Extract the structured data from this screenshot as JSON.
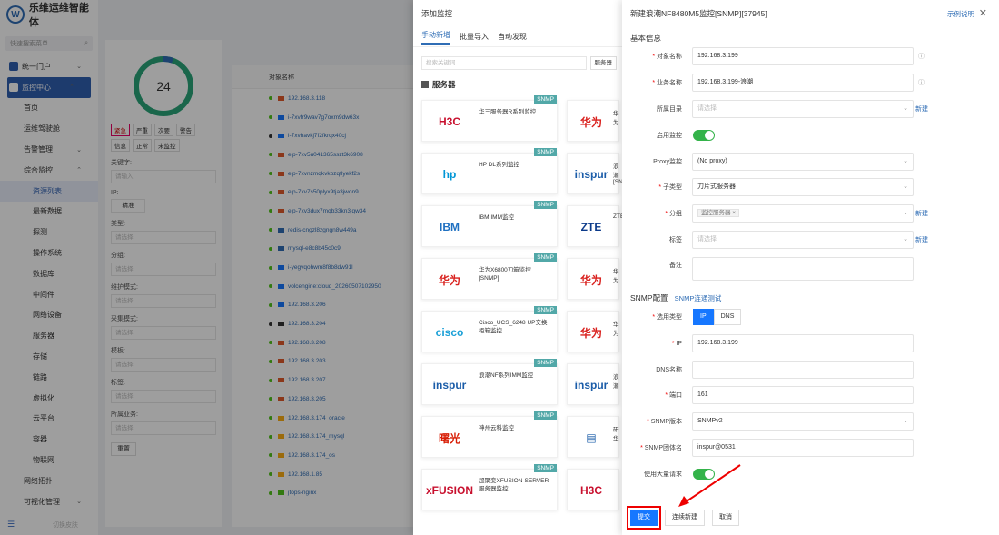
{
  "brand": {
    "name": "乐维运维智能体",
    "logo_letter": "W"
  },
  "sidebar": {
    "search_placeholder": "快速搜索菜单",
    "items": [
      {
        "label": "统一门户",
        "level": 1,
        "chev": "⌄"
      },
      {
        "label": "监控中心",
        "level": 1,
        "chev": "⌃",
        "active": true
      },
      {
        "label": "首页",
        "level": 2
      },
      {
        "label": "运维驾驶舱",
        "level": 2
      },
      {
        "label": "告警管理",
        "level": 2,
        "chev": "⌄"
      },
      {
        "label": "综合监控",
        "level": 2,
        "chev": "⌃"
      },
      {
        "label": "资源列表",
        "level": 3,
        "selected": true
      },
      {
        "label": "最新数据",
        "level": 3
      },
      {
        "label": "探测",
        "level": 3
      },
      {
        "label": "操作系统",
        "level": 3
      },
      {
        "label": "数据库",
        "level": 3
      },
      {
        "label": "中间件",
        "level": 3
      },
      {
        "label": "网络设备",
        "level": 3
      },
      {
        "label": "服务器",
        "level": 3
      },
      {
        "label": "存储",
        "level": 3
      },
      {
        "label": "链路",
        "level": 3
      },
      {
        "label": "虚拟化",
        "level": 3
      },
      {
        "label": "云平台",
        "level": 3
      },
      {
        "label": "容器",
        "level": 3
      },
      {
        "label": "物联网",
        "level": 3
      },
      {
        "label": "网络拓扑",
        "level": 2
      },
      {
        "label": "可视化管理",
        "level": 2,
        "chev": "⌄"
      }
    ],
    "footer": "切换皮肤"
  },
  "filter": {
    "count": "24",
    "tags": [
      "紧急",
      "严重",
      "次要",
      "警告",
      "信息",
      "正常",
      "未监控"
    ],
    "keyword_label": "关键字:",
    "keyword_ph": "请输入",
    "ip_label": "IP:",
    "ip_btn": "精准",
    "type_label": "类型:",
    "type_ph": "请选择",
    "group_label": "分组:",
    "group_ph": "请选择",
    "maint_label": "维护模式:",
    "maint_ph": "请选择",
    "collect_label": "采集模式:",
    "collect_ph": "请选择",
    "template_label": "模板:",
    "template_ph": "请选择",
    "label_label": "标签:",
    "label_ph": "请选择",
    "biz_label": "所属业务:",
    "biz_ph": "请选择",
    "reset": "重置"
  },
  "table": {
    "header": "对象名称",
    "rows": [
      {
        "name": "192.168.3.118",
        "dot": "#52c41a",
        "icon": "#e05a2b"
      },
      {
        "name": "i-7xvfr9wav7g7oxm9dw63x",
        "dot": "#52c41a",
        "icon": "#1677ff"
      },
      {
        "name": "i-7xvhavkj7f2fkrqx40cj",
        "dot": "#333",
        "icon": "#1677ff"
      },
      {
        "name": "eip-7xv5u041365sszt3k6908",
        "dot": "#52c41a",
        "icon": "#e05a2b"
      },
      {
        "name": "eip-7xvnzmqkvkbzqtlyekf2s",
        "dot": "#52c41a",
        "icon": "#e05a2b"
      },
      {
        "name": "eip-7xv7s50plyx9tja3jwon9",
        "dot": "#52c41a",
        "icon": "#e05a2b"
      },
      {
        "name": "eip-7xv3dux7mqb33kn3jqw34",
        "dot": "#52c41a",
        "icon": "#e05a2b"
      },
      {
        "name": "redis-cngzl8zgngn8w449a",
        "dot": "#52c41a",
        "icon": "#2f6db5"
      },
      {
        "name": "mysql-e8c8b45c0c9l",
        "dot": "#52c41a",
        "icon": "#2f6db5"
      },
      {
        "name": "i-yegvqohwm8f8b8dw91l",
        "dot": "#52c41a",
        "icon": "#1677ff"
      },
      {
        "name": "volcengine:cloud_20260507102950",
        "dot": "#52c41a",
        "icon": "#1677ff"
      },
      {
        "name": "192.168.3.206",
        "dot": "#52c41a",
        "icon": "#1677ff"
      },
      {
        "name": "192.168.3.204",
        "dot": "#333",
        "icon": "#333"
      },
      {
        "name": "192.168.3.208",
        "dot": "#52c41a",
        "icon": "#e05a2b"
      },
      {
        "name": "192.168.3.203",
        "dot": "#52c41a",
        "icon": "#e05a2b"
      },
      {
        "name": "192.168.3.207",
        "dot": "#52c41a",
        "icon": "#e05a2b"
      },
      {
        "name": "192.168.3.205",
        "dot": "#52c41a",
        "icon": "#e05a2b"
      },
      {
        "name": "192.168.3.174_oracle",
        "dot": "#52c41a",
        "icon": "#faad14"
      },
      {
        "name": "192.168.3.174_mysql",
        "dot": "#52c41a",
        "icon": "#faad14"
      },
      {
        "name": "192.168.3.174_os",
        "dot": "#52c41a",
        "icon": "#faad14"
      },
      {
        "name": "192.168.1.85",
        "dot": "#52c41a",
        "icon": "#faad14"
      },
      {
        "name": "jtops-nginx",
        "dot": "#52c41a",
        "icon": "#52c41a"
      }
    ]
  },
  "add_drawer": {
    "title": "添加监控",
    "tabs": [
      "手动新增",
      "批量导入",
      "自动发现"
    ],
    "search_ph": "搜索关键词",
    "search_btn": "服务器",
    "section": "服务器",
    "cards": [
      {
        "logo": "H3C",
        "logo_color": "#c8102e",
        "name": "华三服务器R系列监控",
        "badge": "SNMP",
        "right_logo": "华为",
        "right_color": "#d9211e",
        "right_name": "华为"
      },
      {
        "logo": "hp",
        "logo_color": "#0096d6",
        "name": "HP DL系列监控",
        "badge": "SNMP",
        "right_logo": "inspur",
        "right_color": "#1a5ca8",
        "right_name": "浪潮[SN"
      },
      {
        "logo": "IBM",
        "logo_color": "#1f70c1",
        "name": "IBM IMM监控",
        "badge": "SNMP",
        "right_logo": "ZTE",
        "right_color": "#0b3a8a",
        "right_name": "ZTE"
      },
      {
        "logo": "华为",
        "logo_color": "#d9211e",
        "name": "华为X6800刀箱监控[SNMP]",
        "badge": "SNMP",
        "right_logo": "华为",
        "right_color": "#d9211e",
        "right_name": "华为"
      },
      {
        "logo": "cisco",
        "logo_color": "#1ba0d7",
        "name": "Cisco_UCS_6248 UP交换柜箱监控",
        "badge": "SNMP",
        "right_logo": "华为",
        "right_color": "#d9211e",
        "right_name": "华为"
      },
      {
        "logo": "inspur",
        "logo_color": "#1a5ca8",
        "name": "浪潮NF系列IMM监控",
        "badge": "SNMP",
        "right_logo": "inspur",
        "right_color": "#1a5ca8",
        "right_name": "浪潮"
      },
      {
        "logo": "曙光",
        "logo_color": "#d81e06",
        "name": "神州云科监控",
        "badge": "SNMP",
        "right_logo": "▤",
        "right_color": "#1a5ca8",
        "right_name": "研华"
      },
      {
        "logo": "xFUSION",
        "logo_color": "#c8102e",
        "name": "超聚变XFUSION-SERVER服务器监控",
        "badge": "SNMP",
        "right_logo": "H3C",
        "right_color": "#c8102e",
        "right_name": ""
      }
    ]
  },
  "new_drawer": {
    "title": "新建浪潮NF8480M5监控[SNMP][37945]",
    "example": "示例说明",
    "basic_section": "基本信息",
    "fields": {
      "obj_name_label": "对象名称",
      "obj_name": "192.168.3.199",
      "biz_name_label": "业务名称",
      "biz_name": "192.168.3.199-浪潮",
      "dir_label": "所属目录",
      "dir_ph": "请选择",
      "enable_label": "启用监控",
      "proxy_label": "Proxy监控",
      "proxy": "(No proxy)",
      "subtype_label": "子类型",
      "subtype": "刀片式服务器",
      "group_label": "分组",
      "group_chip": "监控服务器",
      "tag_label": "标签",
      "tag_ph": "请选择",
      "note_label": "备注",
      "new_link": "新建"
    },
    "snmp_section": "SNMP配置",
    "snmp_test": "SNMP连通测试",
    "snmp": {
      "usetype_label": "选用类型",
      "opts": [
        "IP",
        "DNS"
      ],
      "ip_label": "IP",
      "ip": "192.168.3.199",
      "dns_label": "DNS名称",
      "port_label": "端口",
      "port": "161",
      "ver_label": "SNMP版本",
      "ver": "SNMPv2",
      "community_label": "SNMP团体名",
      "community": "inspur@0531",
      "bulk_label": "使用大量请求"
    },
    "buttons": {
      "submit": "提交",
      "continue": "连续新建",
      "cancel": "取消"
    }
  }
}
